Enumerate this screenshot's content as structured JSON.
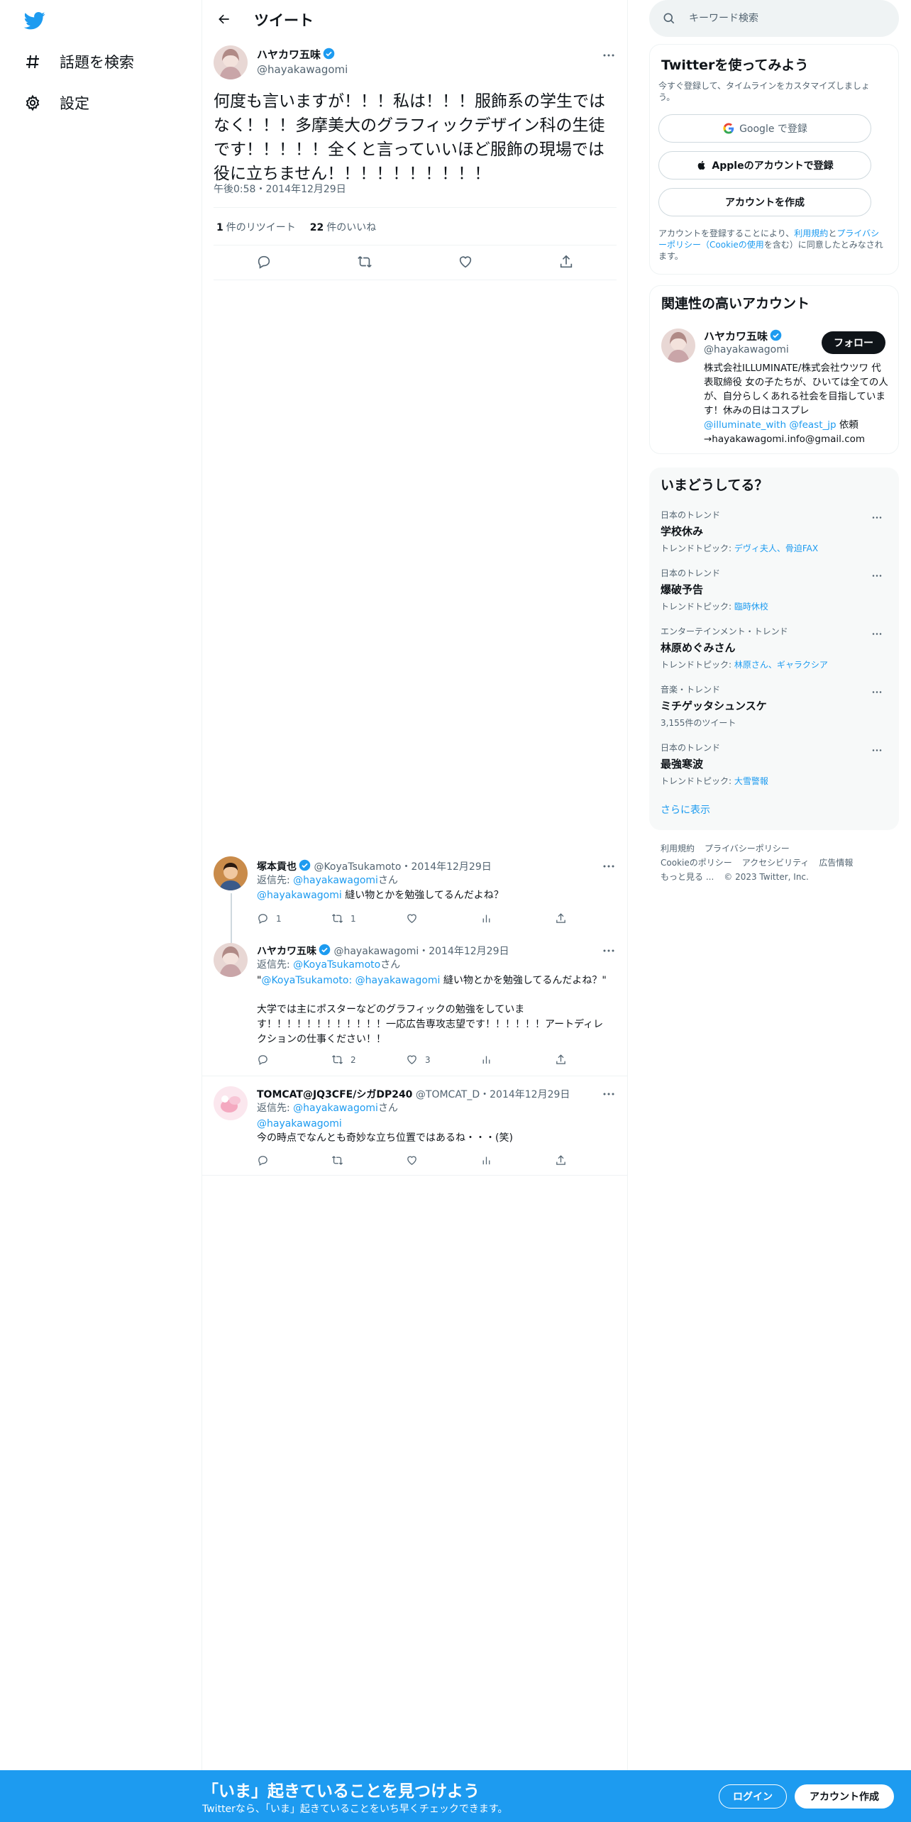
{
  "nav": {
    "items": [
      {
        "label": "話題を検索",
        "icon": "hashtag-icon"
      },
      {
        "label": "設定",
        "icon": "gear-icon"
      }
    ]
  },
  "header": {
    "title": "ツイート"
  },
  "tweet": {
    "author_name": "ハヤカワ五味",
    "author_handle": "@hayakawagomi",
    "text": "何度も言いますが！！！私は！！！服飾系の学生ではなく！！！多摩美大のグラフィックデザイン科の生徒です！！！！！全くと言っていいほど服飾の現場では役に立ちません！！！！！！！！！！",
    "time": "午後0:58・2014年12月29日",
    "retweets_count": "1",
    "retweets_label": "件のリツイート",
    "likes_count": "22",
    "likes_label": "件のいいね"
  },
  "replies": [
    {
      "name": "塚本貢也",
      "handle": "@KoyaTsukamoto",
      "date": "・2014年12月29日",
      "replying_prefix": "返信先: ",
      "replying_to": "@hayakawagomi",
      "replying_suffix": "さん",
      "mention": "@hayakawagomi",
      "text": " 縫い物とかを勉強してるんだよね？",
      "counts": {
        "reply": "1",
        "retweet": "1",
        "like": "",
        "views": ""
      }
    },
    {
      "name": "ハヤカワ五味",
      "handle": "@hayakawagomi",
      "date": "・2014年12月29日",
      "replying_prefix": "返信先: ",
      "replying_to": "@KoyaTsukamoto",
      "replying_suffix": "さん",
      "quote_open": "\"",
      "quote_mention1": "@KoyaTsukamoto",
      "quote_sep": ": ",
      "quote_mention2": "@hayakawagomi",
      "quote_text": " 縫い物とかを勉強してるんだよね？\"",
      "text": "大学では主にポスターなどのグラフィックの勉強をしています！！！！！！！！！！！！一応広告専攻志望です！！！！！！アートディレクションの仕事ください！！",
      "counts": {
        "reply": "",
        "retweet": "2",
        "like": "3",
        "views": ""
      }
    },
    {
      "name": "TOMCAT@JQ3CFE/シガDP240",
      "handle": "@TOMCAT_D",
      "date": "・2014年12月29日",
      "replying_prefix": "返信先: ",
      "replying_to": "@hayakawagomi",
      "replying_suffix": "さん",
      "mention": "@hayakawagomi",
      "text": "今の時点でなんとも奇妙な立ち位置ではあるね・・・(笑)",
      "counts": {
        "reply": "",
        "retweet": "",
        "like": "",
        "views": ""
      }
    }
  ],
  "search": {
    "placeholder": "キーワード検索"
  },
  "signup_panel": {
    "title": "Twitterを使ってみよう",
    "subtitle": "今すぐ登録して、タイムラインをカスタマイズしましょう。",
    "google_label": "Google で登録",
    "apple_label": "Appleのアカウントで登録",
    "create_label": "アカウントを作成",
    "tos_prefix": "アカウントを登録することにより、",
    "tos_terms": "利用規約",
    "tos_and": "と",
    "tos_privacy": "プライバシーポリシー（Cookieの使用",
    "tos_suffix": "を含む）に同意したとみなされます。"
  },
  "related": {
    "title": "関連性の高いアカウント",
    "name": "ハヤカワ五味",
    "handle": "@hayakawagomi",
    "follow_label": "フォロー",
    "bio_text": "株式会社ILLUMINATE/株式会社ウツワ 代表取締役 女の子たちが、ひいては全ての人が、自分らしくあれる社会を目指しています！休みの日はコスプレ ",
    "bio_mention1": "@illuminate_with",
    "bio_mention2": "@feast_jp",
    "bio_suffix": " 依頼→hayakawagomi.info@gmail.com"
  },
  "trends": {
    "title": "いまどうしてる？",
    "items": [
      {
        "category": "日本のトレンド",
        "name": "学校休み",
        "topic_prefix": "トレンドトピック: ",
        "topic_links": "デヴィ夫人、骨迫FAX"
      },
      {
        "category": "日本のトレンド",
        "name": "爆破予告",
        "topic_prefix": "トレンドトピック: ",
        "topic_links": "臨時休校"
      },
      {
        "category": "エンターテインメント・トレンド",
        "name": "林原めぐみさん",
        "topic_prefix": "トレンドトピック: ",
        "topic_links": "林原さん、ギャラクシア"
      },
      {
        "category": "音楽・トレンド",
        "name": "ミチゲッタシュンスケ",
        "topic_prefix": "3,155件のツイート",
        "topic_links": ""
      },
      {
        "category": "日本のトレンド",
        "name": "最強寒波",
        "topic_prefix": "トレンドトピック: ",
        "topic_links": "大雪警報"
      }
    ],
    "show_more": "さらに表示"
  },
  "footer": {
    "line1": [
      "利用規約",
      "プライバシーポリシー"
    ],
    "line2": [
      "Cookieのポリシー",
      "アクセシビリティ",
      "広告情報"
    ],
    "line3": [
      "もっと見る ...",
      "© 2023 Twitter, Inc."
    ]
  },
  "bottom_bar": {
    "title": "「いま」起きていることを見つけよう",
    "subtitle": "Twitterなら、「いま」起きていることをいち早くチェックできます。",
    "login_label": "ログイン",
    "signup_label": "アカウント作成"
  },
  "colors": {
    "accent": "#1d9bf0",
    "text": "#0f1419",
    "muted": "#536471"
  }
}
